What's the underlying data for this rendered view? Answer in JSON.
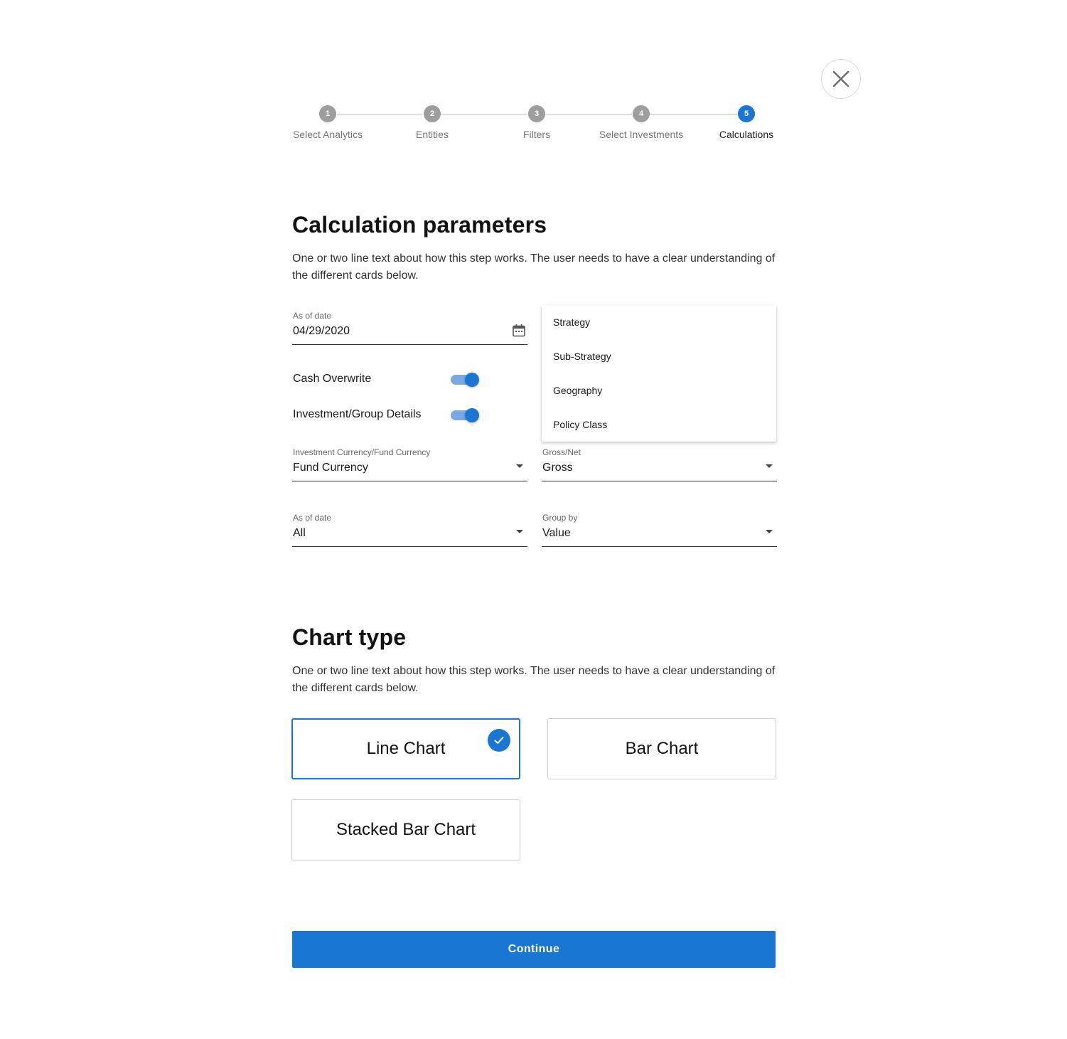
{
  "stepper": {
    "steps": [
      {
        "number": "1",
        "label": "Select Analytics",
        "active": false
      },
      {
        "number": "2",
        "label": "Entities",
        "active": false
      },
      {
        "number": "3",
        "label": "Filters",
        "active": false
      },
      {
        "number": "4",
        "label": "Select Investments",
        "active": false
      },
      {
        "number": "5",
        "label": "Calculations",
        "active": true
      }
    ]
  },
  "calculation": {
    "title": "Calculation parameters",
    "description": "One or two line text about how this step works. The user needs to have a clear understanding of the different cards below.",
    "as_of_date": {
      "label": "As of date",
      "value": "04/29/2020"
    },
    "toggles": [
      {
        "label": "Cash Overwrite",
        "on": true
      },
      {
        "label": "Investment/Group Details",
        "on": true
      }
    ],
    "currency": {
      "label": "Investment Currency/Fund Currency",
      "value": "Fund Currency"
    },
    "gross_net": {
      "label": "Gross/Net",
      "value": "Gross"
    },
    "as_of_date_range": {
      "label": "As of date",
      "value": "All"
    },
    "group_by": {
      "label": "Group by",
      "value": "Value"
    },
    "dropdown_menu": {
      "options": [
        "Strategy",
        "Sub-Strategy",
        "Geography",
        "Policy Class"
      ]
    }
  },
  "chart_type": {
    "title": "Chart type",
    "description": "One or two line text about how this step works. The user needs to have a clear understanding of the different cards below.",
    "cards": [
      {
        "label": "Line Chart",
        "selected": true
      },
      {
        "label": "Bar Chart",
        "selected": false
      },
      {
        "label": "Stacked Bar Chart",
        "selected": false
      }
    ]
  },
  "continue_label": "Continue",
  "colors": {
    "accent": "#1976d2",
    "inactive_step": "#9e9e9e",
    "toggle_track": "#78a9e3"
  },
  "icons": {
    "close": "close-icon",
    "calendar": "calendar-icon",
    "check": "check-icon",
    "dropdown": "chevron-down-icon"
  }
}
